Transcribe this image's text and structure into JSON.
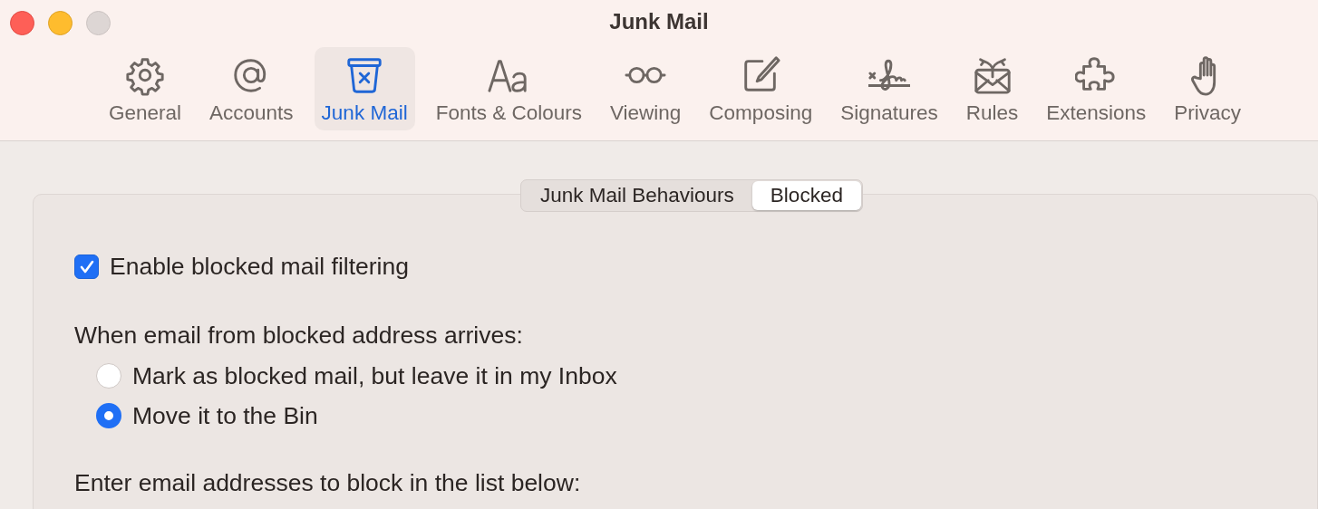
{
  "window": {
    "title": "Junk Mail"
  },
  "toolbar": [
    {
      "label": "General",
      "kind": "gear",
      "selected": false
    },
    {
      "label": "Accounts",
      "kind": "at",
      "selected": false
    },
    {
      "label": "Junk Mail",
      "kind": "junk",
      "selected": true
    },
    {
      "label": "Fonts & Colours",
      "kind": "fonts",
      "selected": false
    },
    {
      "label": "Viewing",
      "kind": "glasses",
      "selected": false
    },
    {
      "label": "Composing",
      "kind": "compose",
      "selected": false
    },
    {
      "label": "Signatures",
      "kind": "signature",
      "selected": false
    },
    {
      "label": "Rules",
      "kind": "rules",
      "selected": false
    },
    {
      "label": "Extensions",
      "kind": "puzzle",
      "selected": false
    },
    {
      "label": "Privacy",
      "kind": "hand",
      "selected": false
    }
  ],
  "segments": [
    {
      "label": "Junk Mail Behaviours",
      "selected": false
    },
    {
      "label": "Blocked",
      "selected": true
    }
  ],
  "enable_filtering": {
    "label": "Enable blocked mail filtering",
    "checked": true
  },
  "arrival_prompt": "When email from blocked address arrives:",
  "arrival_options": [
    {
      "label": "Mark as blocked mail, but leave it in my Inbox",
      "selected": false
    },
    {
      "label": "Move it to the Bin",
      "selected": true
    }
  ],
  "list_prompt": "Enter email addresses to block in the list below:"
}
